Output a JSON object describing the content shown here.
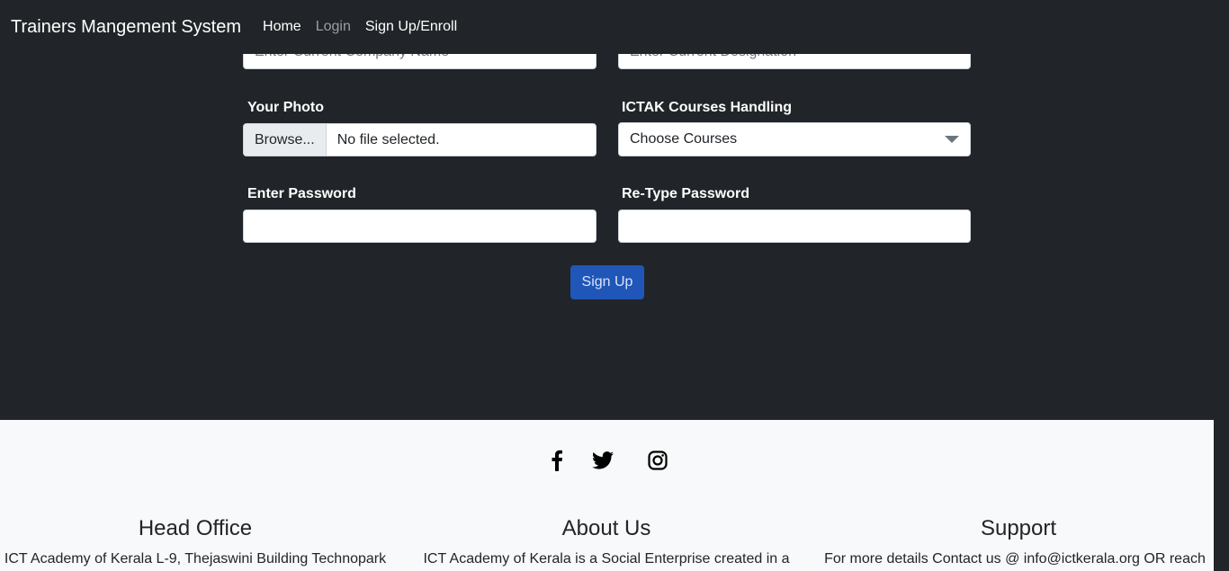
{
  "navbar": {
    "brand": "Trainers Mangement System",
    "links": [
      {
        "label": "Home"
      },
      {
        "label": "Login"
      },
      {
        "label": "Sign Up/Enroll"
      }
    ]
  },
  "form": {
    "company": {
      "placeholder": "Enter Current Company Name"
    },
    "designation": {
      "placeholder": "Enter Current Designation"
    },
    "photo": {
      "label": "Your Photo",
      "browse_label": "Browse...",
      "file_status": "No file selected."
    },
    "courses": {
      "label": "ICTAK Courses Handling",
      "selected": "Choose Courses"
    },
    "password": {
      "label": "Enter Password",
      "value": ""
    },
    "retype_password": {
      "label": "Re-Type Password",
      "value": ""
    },
    "submit_label": "Sign Up"
  },
  "colors": {
    "page_bg": "#212529",
    "footer_bg": "#f8f9fa",
    "primary_button": "#1f56b8"
  },
  "footer": {
    "social": [
      {
        "icon": "facebook-icon"
      },
      {
        "icon": "twitter-icon"
      },
      {
        "icon": "instagram-icon"
      }
    ],
    "columns": [
      {
        "title": "Head Office",
        "text": "ICT Academy of Kerala L-9, Thejaswini Building Technopark"
      },
      {
        "title": "About Us",
        "text": "ICT Academy of Kerala is a Social Enterprise created in a"
      },
      {
        "title": "Support",
        "text": "For more details Contact us @ info@ictkerala.org OR reach"
      }
    ]
  }
}
